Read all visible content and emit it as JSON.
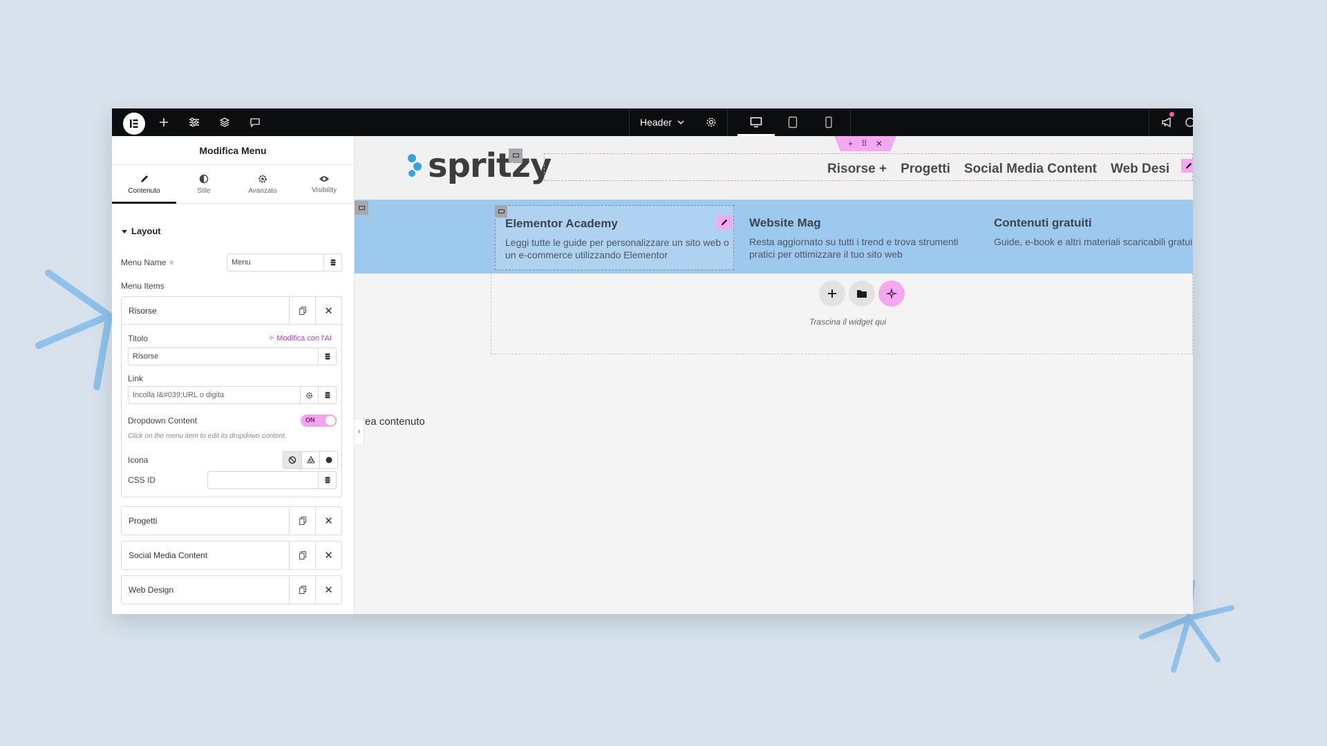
{
  "topbar": {
    "header_label": "Header"
  },
  "panel": {
    "title": "Modifica Menu",
    "tabs": [
      {
        "label": "Contenuto",
        "icon": "pencil-icon"
      },
      {
        "label": "Stile",
        "icon": "contrast-icon"
      },
      {
        "label": "Avanzato",
        "icon": "gear-icon"
      },
      {
        "label": "Visibility",
        "icon": "eye-icon"
      }
    ],
    "section": "Layout",
    "menu_name_label": "Menu Name",
    "menu_name_value": "Menu",
    "menu_items_label": "Menu Items",
    "items": [
      {
        "label": "Risorse"
      },
      {
        "label": "Progetti"
      },
      {
        "label": "Social Media Content"
      },
      {
        "label": "Web Design"
      }
    ],
    "expanded": {
      "title_label": "Titolo",
      "ai_link": "Modifica con l'AI",
      "title_value": "Risorse",
      "link_label": "Link",
      "link_placeholder": "Incolla l&#039;URL o digita",
      "dropdown_label": "Dropdown Content",
      "toggle_text": "ON",
      "hint": "Click on the menu item to edit its dropdown content.",
      "icon_label": "Icona",
      "css_id_label": "CSS ID"
    }
  },
  "canvas": {
    "brand": "spritzy",
    "nav": [
      "Risorse",
      "Progetti",
      "Social Media Content",
      "Web Desi"
    ],
    "nav_plus": "+",
    "mega": [
      {
        "title": "Elementor Academy",
        "desc": "Leggi tutte le guide per personalizzare un sito web o un e-commerce utilizzando Elementor"
      },
      {
        "title": "Website Mag",
        "desc": "Resta aggiornato su tutti i trend e trova strumenti pratici per ottimizzare il tuo sito web"
      },
      {
        "title": "Contenuti gratuiti",
        "desc": "Guide, e-book e altri materiali scaricabili gratuitamente, per la crescita del tuo busi"
      }
    ],
    "drop_hint": "Trascina il widget qui",
    "area_label": "Area contenuto"
  },
  "colors": {
    "accent_pink": "#f4a8ef",
    "ai_purple": "#c036c8",
    "mega_blue": "#9dc9ee",
    "brand_blue": "#3aa0e0"
  }
}
